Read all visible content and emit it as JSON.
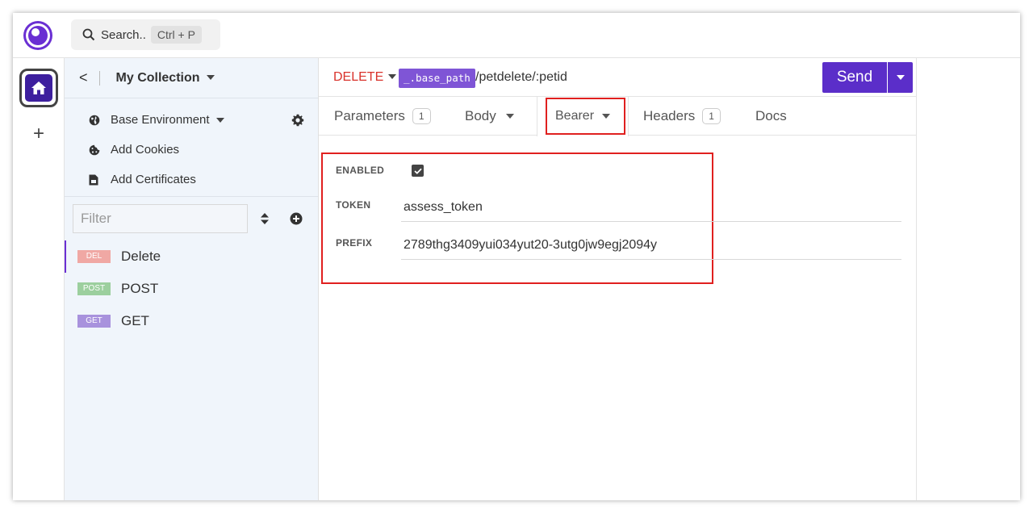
{
  "topbar": {
    "search_label": "Search..",
    "search_shortcut": "Ctrl + P"
  },
  "rail": {
    "home_icon": "home-icon",
    "add_label": "+"
  },
  "sidebar": {
    "collection_title": "My Collection",
    "back_label": "<",
    "environment": {
      "label": "Base Environment"
    },
    "cookies_label": "Add Cookies",
    "certificates_label": "Add Certificates",
    "filter_placeholder": "Filter",
    "requests": [
      {
        "method_badge": "DEL",
        "name": "Delete",
        "color": "#f0a8a4",
        "active": true
      },
      {
        "method_badge": "POST",
        "name": "POST",
        "color": "#9ccf9e",
        "active": false
      },
      {
        "method_badge": "GET",
        "name": "GET",
        "color": "#a892dd",
        "active": false
      }
    ]
  },
  "request": {
    "method": "DELETE",
    "base_tag": "_.base_path",
    "path": "/petdelete/:petid",
    "send_label": "Send",
    "method_color": "#d9322b",
    "accent_color": "#5b2ec9"
  },
  "tabs": {
    "parameters": {
      "label": "Parameters",
      "count": "1"
    },
    "body": {
      "label": "Body"
    },
    "bearer": {
      "label": "Bearer"
    },
    "headers": {
      "label": "Headers",
      "count": "1"
    },
    "docs": {
      "label": "Docs"
    }
  },
  "bearer": {
    "enabled_label": "ENABLED",
    "enabled": true,
    "token_label": "TOKEN",
    "token_value": "assess_token",
    "prefix_label": "PREFIX",
    "prefix_value": "2789thg3409yui034yut20-3utg0jw9egj2094y"
  }
}
